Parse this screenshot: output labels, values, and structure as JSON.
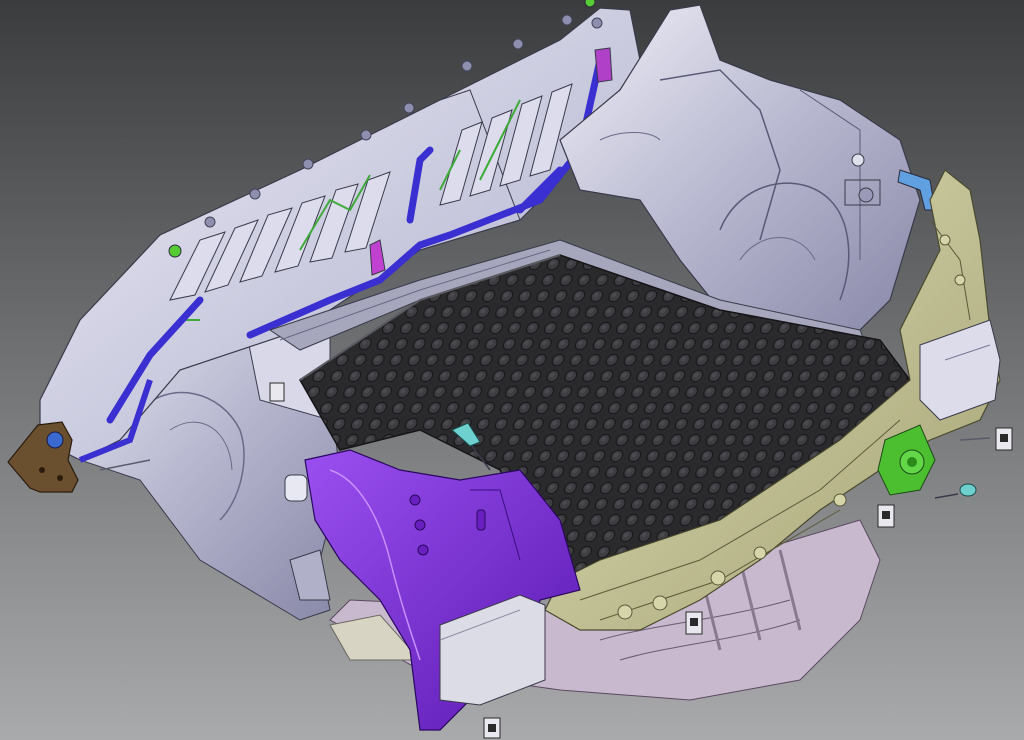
{
  "viewport": {
    "background_top": "#3a3c3e",
    "background_bottom": "#a9aaab"
  },
  "colors": {
    "body_panel": "#c8c8dc",
    "body_panel_dark": "#9a9ab8",
    "body_panel_light": "#e4e4f0",
    "floor_mat": "#2c2c2e",
    "floor_mat_bump": "#3c3c40",
    "floor_mat_edge": "#1a1a1c",
    "seat_frame_blue": "#3a2fd0",
    "rear_panel_yellow": "#c9c89a",
    "rear_panel_yellow_dark": "#a5a477",
    "purple_reinforcement": "#7a2ad8",
    "purple_reinforcement_dark": "#5a18b0",
    "lower_pink": "#c7b6cc",
    "hinge_brown": "#6b5030",
    "lamp_green": "#55cc33",
    "clip_cyan": "#6fd0d0",
    "magenta_bracket": "#c040d0",
    "light_blue_bracket": "#60a0e0",
    "edge_line": "#3a3a4a"
  },
  "parts": [
    "rear-seat-back-frame",
    "trunk-floor-mat",
    "left-wheel-arch",
    "right-wheel-arch",
    "rear-end-panel",
    "left-purple-reinforcement",
    "left-brown-hinge",
    "right-green-lamp-mount",
    "right-cyan-clip",
    "loose-fasteners"
  ]
}
